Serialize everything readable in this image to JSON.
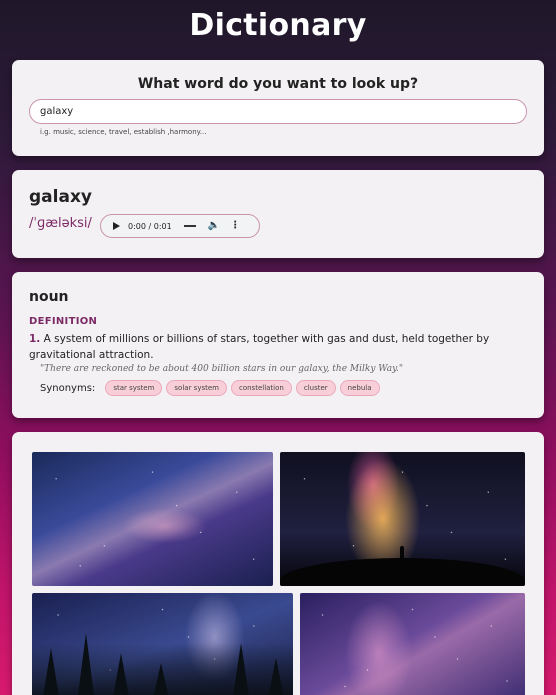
{
  "app": {
    "title": "Dictionary"
  },
  "search": {
    "question": "What word do you want to look up?",
    "value": "galaxy",
    "hint": "i.g. music, science, travel, establish ,harmony..."
  },
  "word": {
    "text": "galaxy",
    "phonetic": "/ˈɡæləksi/",
    "audio": {
      "time": "0:00 / 0:01"
    }
  },
  "meaning": {
    "part_of_speech": "noun",
    "definition_heading": "DEFINITION",
    "definition_number": "1.",
    "definition": "A system of millions or billions of stars, together with gas and dust, held together by gravitational attraction.",
    "example": "\"There are reckoned to be about 400 billion stars in our galaxy, the Milky Way.\"",
    "synonyms_label": "Synonyms:",
    "synonyms": [
      "star system",
      "solar system",
      "constellation",
      "cluster",
      "nebula"
    ]
  },
  "photos": [
    {
      "subject": "milky way over blue sky"
    },
    {
      "subject": "person silhouette under glowing galaxy"
    },
    {
      "subject": "milky way above pine trees"
    },
    {
      "subject": "purple milky way"
    }
  ],
  "colors": {
    "accent": "#7b2a66",
    "chip_bg": "#f8cfd9",
    "card_bg": "#f4f1f4"
  }
}
